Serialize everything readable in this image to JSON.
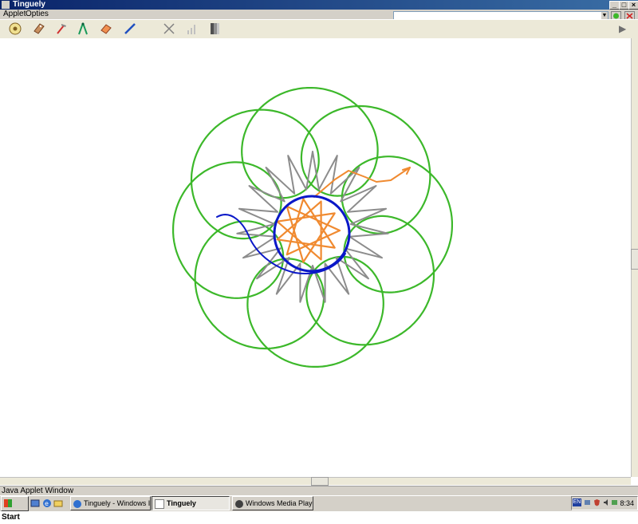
{
  "window": {
    "title": "Tinguely",
    "minimize": "_",
    "maximize": "□",
    "close": "×"
  },
  "menubar": {
    "items": [
      "Applet",
      "Opties"
    ]
  },
  "toolbar": {
    "tools": [
      "wheel-icon",
      "tag-icon",
      "hammer-icon",
      "compass-icon",
      "rubber-icon",
      "pen-icon",
      "cross-icon",
      "chart-icon",
      "grey-bar-icon"
    ],
    "play": "▶"
  },
  "drawing": {
    "colors": {
      "green": "#3cb82a",
      "grey": "#8c8c8c",
      "orange": "#f08a30",
      "blue": "#0a18c8"
    }
  },
  "status": {
    "text": "Java Applet Window"
  },
  "taskbar": {
    "start": "Start",
    "tasks": [
      {
        "label": "Tinguely - Windows Inter...",
        "active": false
      },
      {
        "label": "Tinguely",
        "active": true
      },
      {
        "label": "Windows Media Player",
        "active": false
      }
    ],
    "lang": "EN",
    "clock": "8:34"
  }
}
